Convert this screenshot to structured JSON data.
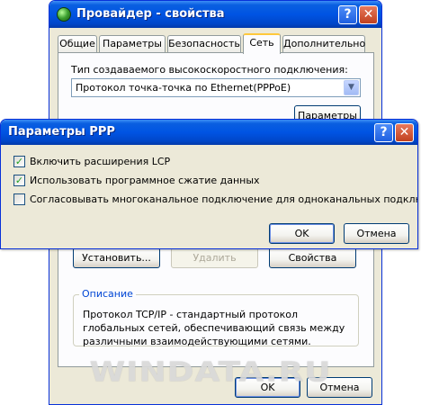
{
  "back_window": {
    "title": "Провайдер - свойства",
    "help_glyph": "?",
    "close_glyph": "✕",
    "tabs": [
      "Общие",
      "Параметры",
      "Безопасность",
      "Сеть",
      "Дополнительно"
    ],
    "active_tab": "Сеть",
    "connection_type_label": "Тип создаваемого высокоскоростного подключения:",
    "connection_type_value": "Протокол точка-точка по Ethernet(PPPoE)",
    "settings_button": "Параметры",
    "install_button": "Установить...",
    "remove_button": "Удалить",
    "properties_button": "Свойства",
    "description_title": "Описание",
    "description_text": "Протокол TCP/IP - стандартный протокол глобальных сетей, обеспечивающий связь между различными взаимодействующими сетями.",
    "ok_button": "OK",
    "cancel_button": "Отмена"
  },
  "ppp_dialog": {
    "title": "Параметры PPP",
    "help_glyph": "?",
    "close_glyph": "✕",
    "options": [
      {
        "label": "Включить расширения LCP",
        "checked": true
      },
      {
        "label": "Использовать программное сжатие данных",
        "checked": true
      },
      {
        "label": "Согласовывать многоканальное подключение для одноканальных подключений",
        "checked": false
      }
    ],
    "ok_button": "OK",
    "cancel_button": "Отмена"
  },
  "watermark": "WINDATA.RU",
  "colors": {
    "titlebar": "#0054e3",
    "window_face": "#ece9d8",
    "tab_highlight": "#ffc83c",
    "checkmark": "#21a121",
    "group_legend": "#0046d5"
  }
}
